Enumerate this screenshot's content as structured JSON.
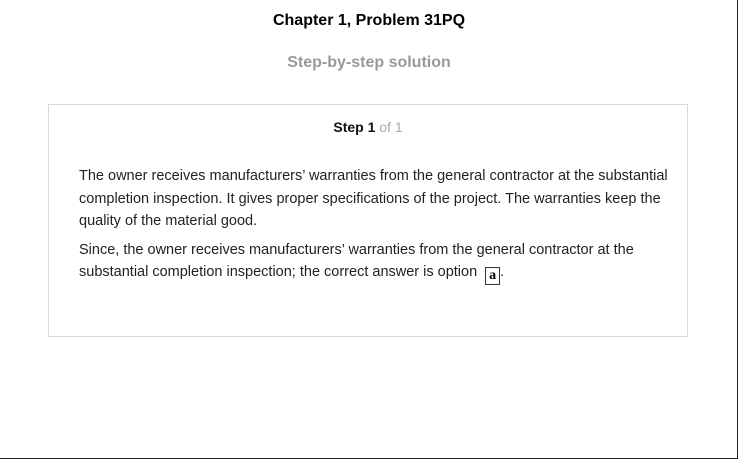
{
  "header": {
    "title": "Chapter 1, Problem 31PQ",
    "subtitle": "Step-by-step solution"
  },
  "step": {
    "label": "Step 1",
    "of_text": "of 1",
    "paragraph1": "The owner receives manufacturers’ warranties from the general contractor at the substantial completion inspection. It gives proper specifications of the project. The warranties keep the quality of the material good.",
    "paragraph2": "Since, the owner receives manufacturers’ warranties from the general contractor at the substantial completion inspection; the correct answer is option",
    "answer": "a",
    "trailing": "."
  }
}
